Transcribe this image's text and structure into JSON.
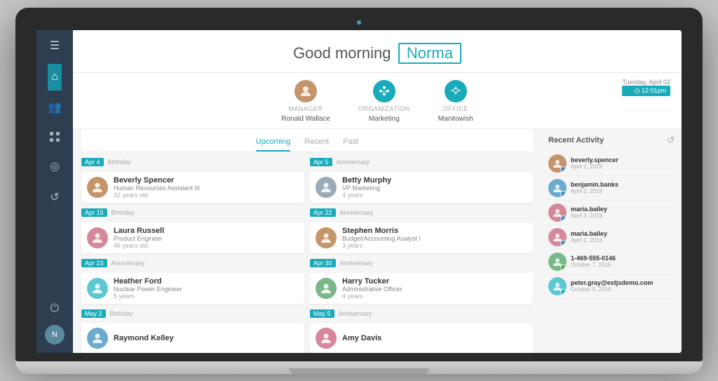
{
  "laptop": {
    "camera_dot": true
  },
  "sidebar": {
    "menu_icon": "☰",
    "items": [
      {
        "id": "home",
        "icon": "⌂",
        "active": true
      },
      {
        "id": "people",
        "icon": "👥",
        "active": false
      },
      {
        "id": "org",
        "icon": "⊞",
        "active": false
      },
      {
        "id": "globe",
        "icon": "◎",
        "active": false
      },
      {
        "id": "refresh",
        "icon": "↺",
        "active": false
      }
    ],
    "avatar_initials": "N"
  },
  "greeting": {
    "prefix": "Good morning",
    "name": "Norma"
  },
  "info_bar": {
    "manager_label": "MANAGER",
    "manager_name": "Ronald Wallace",
    "org_label": "ORGANIZATION",
    "org_name": "Marketing",
    "office_label": "OFFICE",
    "office_name": "Manitowish",
    "date": "Tuesday, April 02",
    "time": "◷ 12:01pm"
  },
  "tabs": {
    "items": [
      {
        "id": "upcoming",
        "label": "Upcoming",
        "active": true
      },
      {
        "id": "recent",
        "label": "Recent",
        "active": false
      },
      {
        "id": "past",
        "label": "Past",
        "active": false
      }
    ]
  },
  "events_left": [
    {
      "date": "Apr 4",
      "type": "Birthday",
      "name": "Beverly Spencer",
      "title": "Human Resources Assistant III",
      "sub": "32 years old",
      "av_class": "av-brown"
    },
    {
      "date": "Apr 15",
      "type": "Birthday",
      "name": "Laura Russell",
      "title": "Product Engineer",
      "sub": "46 years old",
      "av_class": "av-pink"
    },
    {
      "date": "Apr 23",
      "type": "Anniversary",
      "name": "Heather Ford",
      "title": "Nuclear Power Engineer",
      "sub": "5 years",
      "av_class": "av-teal"
    },
    {
      "date": "May 2",
      "type": "Birthday",
      "name": "Raymond Kelley",
      "title": "",
      "sub": "",
      "av_class": "av-blue"
    }
  ],
  "events_right": [
    {
      "date": "Apr 5",
      "type": "Anniversary",
      "name": "Betty Murphy",
      "title": "VP Marketing",
      "sub": "4 years",
      "av_class": "av-gray"
    },
    {
      "date": "Apr 22",
      "type": "Anniversary",
      "name": "Stephen Morris",
      "title": "Budget/Accounting Analyst I",
      "sub": "3 years",
      "av_class": "av-brown"
    },
    {
      "date": "Apr 30",
      "type": "Anniversary",
      "name": "Harry Tucker",
      "title": "Administrative Officer",
      "sub": "4 years",
      "av_class": "av-green"
    },
    {
      "date": "May 5",
      "type": "Anniversary",
      "name": "Amy Davis",
      "title": "",
      "sub": "",
      "av_class": "av-pink"
    }
  ],
  "recent_activity": {
    "title": "Recent Activity",
    "refresh_icon": "↺",
    "items": [
      {
        "name": "beverly.spencer",
        "date": "April 2, 2019",
        "av_class": "av-brown",
        "indicator": "blue"
      },
      {
        "name": "benjamin.banks",
        "date": "April 2, 2019",
        "av_class": "av-blue",
        "indicator": "blue"
      },
      {
        "name": "maria.bailey",
        "date": "April 2, 2019",
        "av_class": "av-pink",
        "indicator": "blue"
      },
      {
        "name": "maria.bailey",
        "date": "April 2, 2019",
        "av_class": "av-pink",
        "indicator": "blue"
      },
      {
        "name": "1-469-555-0146",
        "date": "October 7, 2016",
        "av_class": "av-green",
        "indicator": "green"
      },
      {
        "name": "peter.gray@extjsdemo.com",
        "date": "October 5, 2016",
        "av_class": "av-teal",
        "indicator": "teal"
      }
    ]
  }
}
